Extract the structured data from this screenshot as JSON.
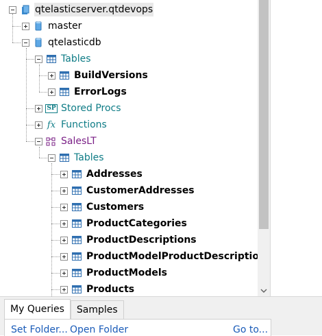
{
  "tree": {
    "server": "qtelasticserver.qtdevops",
    "db_master": "master",
    "db_elastic": "qtelasticdb",
    "tables": "Tables",
    "table_buildversions": "BuildVersions",
    "table_errorlogs": "ErrorLogs",
    "stored_procs": "Stored Procs",
    "stored_procs_badge": "SP",
    "functions": "Functions",
    "functions_badge": "fx",
    "schema_saleslt": "SalesLT",
    "saleslt_tables": "Tables",
    "saleslt_table_items": [
      "Addresses",
      "CustomerAddresses",
      "Customers",
      "ProductCategories",
      "ProductDescriptions",
      "ProductModelProductDescriptions",
      "ProductModels",
      "Products"
    ]
  },
  "bottom": {
    "tab_my_queries": "My Queries",
    "tab_samples": "Samples",
    "set_folder": "Set Folder...",
    "open_folder": "Open Folder",
    "go_to": "Go to..."
  },
  "colors": {
    "teal_label": "#0e7c86",
    "purple_label": "#7a1f86",
    "link": "#1a5bb8",
    "scroll_thumb": "#c2c2c2"
  }
}
